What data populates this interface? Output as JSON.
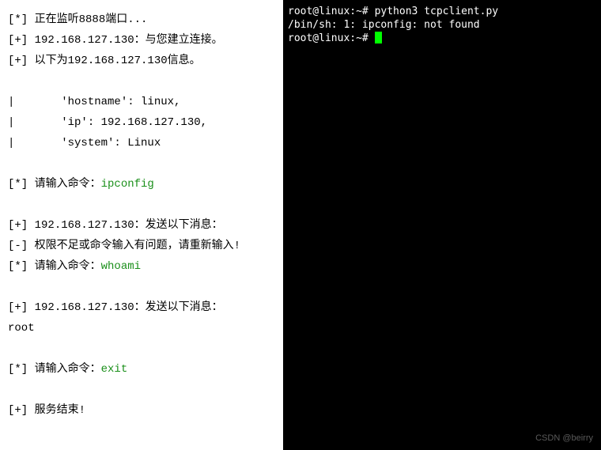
{
  "left": {
    "l1_prefix": "[*] ",
    "l1_text": "正在监听8888端口...",
    "l2_prefix": "[+] ",
    "l2_text": "192.168.127.130：与您建立连接。",
    "l3_prefix": "[+] ",
    "l3_text": "以下为192.168.127.130信息。",
    "info1": "|       'hostname': linux,",
    "info2": "|       'ip': 192.168.127.130,",
    "info3": "|       'system': Linux",
    "p1_prefix": "[*] ",
    "p1_text": "请输入命令：",
    "p1_cmd": "ipconfig",
    "m1_prefix": "[+] ",
    "m1_text": "192.168.127.130：发送以下消息：",
    "err_prefix": "[-] ",
    "err_text": "权限不足或命令输入有问题，请重新输入!",
    "p2_prefix": "[*] ",
    "p2_text": "请输入命令：",
    "p2_cmd": "whoami",
    "m2_prefix": "[+] ",
    "m2_text": "192.168.127.130：发送以下消息：",
    "out1": "root",
    "p3_prefix": "[*] ",
    "p3_text": "请输入命令：",
    "p3_cmd": "exit",
    "end_prefix": "[+] ",
    "end_text": "服务结束!"
  },
  "right": {
    "r1_prompt": "root@linux:~# ",
    "r1_cmd": "python3 tcpclient.py",
    "r2": "/bin/sh: 1: ipconfig: not found",
    "r3_prompt": "root@linux:~# "
  },
  "watermark": "CSDN @beirry"
}
